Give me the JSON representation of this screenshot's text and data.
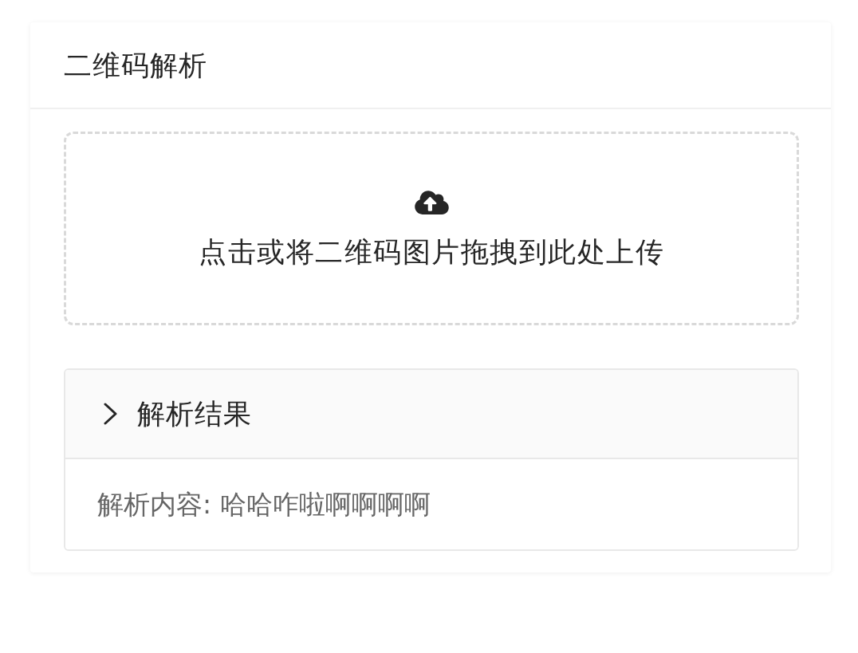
{
  "card": {
    "title": "二维码解析"
  },
  "upload": {
    "hint": "点击或将二维码图片拖拽到此处上传"
  },
  "result_panel": {
    "title": "解析结果",
    "expanded": true,
    "content": "解析内容: 哈哈咋啦啊啊啊啊"
  }
}
